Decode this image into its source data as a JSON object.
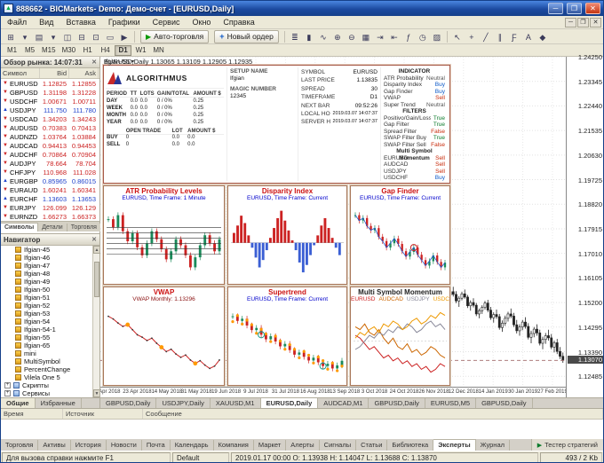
{
  "window": {
    "title": "888662 - BICMarkets- Demo: Демо-счет - [EURUSD,Daily]",
    "buttons": {
      "minimize": "─",
      "maximize": "❐",
      "close": "✕"
    }
  },
  "menu": {
    "items": [
      "Файл",
      "Вид",
      "Вставка",
      "Графики",
      "Сервис",
      "Окно",
      "Справка"
    ]
  },
  "toolbar": {
    "left_icons": [
      {
        "name": "new-chart",
        "glyph": "⊞"
      },
      {
        "name": "new-chart-dropdown",
        "glyph": "▾"
      },
      {
        "name": "profiles",
        "glyph": "▤"
      },
      {
        "name": "profiles-dropdown",
        "glyph": "▾"
      },
      {
        "name": "market-watch-toggle",
        "glyph": "◫"
      },
      {
        "name": "data-window-toggle",
        "glyph": "⊟"
      },
      {
        "name": "navigator-toggle",
        "glyph": "⊡"
      },
      {
        "name": "terminal-toggle",
        "glyph": "▭"
      },
      {
        "name": "strategy-tester-toggle",
        "glyph": "▶"
      }
    ],
    "autotrade_label": "Авто-торговля",
    "new_order_label": "Новый ордер",
    "mid_icons": [
      {
        "name": "bar-chart-mode",
        "glyph": "≣"
      },
      {
        "name": "candlestick-mode",
        "glyph": "▮"
      },
      {
        "name": "line-chart-mode",
        "glyph": "∿"
      },
      {
        "name": "zoom-in",
        "glyph": "⊕"
      },
      {
        "name": "zoom-out",
        "glyph": "⊖"
      },
      {
        "name": "tile-windows",
        "glyph": "▦"
      },
      {
        "name": "auto-scroll",
        "glyph": "⇥"
      },
      {
        "name": "chart-shift",
        "glyph": "⇤"
      },
      {
        "name": "indicators-list",
        "glyph": "ƒ"
      },
      {
        "name": "periods-list",
        "glyph": "◷"
      },
      {
        "name": "templates",
        "glyph": "▨"
      }
    ],
    "right_icons": [
      {
        "name": "cursor-tool",
        "glyph": "↖"
      },
      {
        "name": "crosshair-tool",
        "glyph": "+"
      },
      {
        "name": "trendline-tool",
        "glyph": "╱"
      },
      {
        "name": "channel-tool",
        "glyph": "∥"
      },
      {
        "name": "fibonacci-tool",
        "glyph": "Ƒ"
      },
      {
        "name": "text-tool",
        "glyph": "A"
      },
      {
        "name": "arrows-tool",
        "glyph": "◆"
      }
    ]
  },
  "timeframes": {
    "items": [
      "M1",
      "M5",
      "M15",
      "M30",
      "H1",
      "H4",
      "D1",
      "W1",
      "MN"
    ],
    "active": "D1"
  },
  "market_watch": {
    "title": "Обзор рынка: 14:07:31",
    "columns": [
      "Символ",
      "Bid",
      "Ask"
    ],
    "rows": [
      {
        "symbol": "EURUSD",
        "bid": "1.12825",
        "ask": "1.12855",
        "dir": "down"
      },
      {
        "symbol": "GBPUSD",
        "bid": "1.31198",
        "ask": "1.31228",
        "dir": "down"
      },
      {
        "symbol": "USDCHF",
        "bid": "1.00671",
        "ask": "1.00711",
        "dir": "down"
      },
      {
        "symbol": "USDJPY",
        "bid": "111.750",
        "ask": "111.780",
        "dir": "up"
      },
      {
        "symbol": "USDCAD",
        "bid": "1.34203",
        "ask": "1.34243",
        "dir": "down"
      },
      {
        "symbol": "AUDUSD",
        "bid": "0.70383",
        "ask": "0.70413",
        "dir": "down"
      },
      {
        "symbol": "AUDNZD",
        "bid": "1.03764",
        "ask": "1.03884",
        "dir": "down"
      },
      {
        "symbol": "AUDCAD",
        "bid": "0.94413",
        "ask": "0.94453",
        "dir": "down"
      },
      {
        "symbol": "AUDCHF",
        "bid": "0.70864",
        "ask": "0.70904",
        "dir": "down"
      },
      {
        "symbol": "AUDJPY",
        "bid": "78.664",
        "ask": "78.704",
        "dir": "down"
      },
      {
        "symbol": "CHFJPY",
        "bid": "110.968",
        "ask": "111.028",
        "dir": "down"
      },
      {
        "symbol": "EURGBP",
        "bid": "0.85965",
        "ask": "0.86015",
        "dir": "up"
      },
      {
        "symbol": "EURAUD",
        "bid": "1.60241",
        "ask": "1.60341",
        "dir": "down"
      },
      {
        "symbol": "EURCHF",
        "bid": "1.13603",
        "ask": "1.13653",
        "dir": "up"
      },
      {
        "symbol": "EURJPY",
        "bid": "126.099",
        "ask": "126.129",
        "dir": "down"
      },
      {
        "symbol": "EURNZD",
        "bid": "1.66273",
        "ask": "1.66373",
        "dir": "down"
      }
    ],
    "tabs": [
      "Символы",
      "Детали",
      "Торговля"
    ],
    "active_tab": "Символы"
  },
  "navigator": {
    "title": "Навигатор",
    "items": [
      {
        "label": "Ifgian-45",
        "kind": "expert"
      },
      {
        "label": "Ifgian-46",
        "kind": "expert"
      },
      {
        "label": "Ifgian-47",
        "kind": "expert"
      },
      {
        "label": "Ifgian-48",
        "kind": "expert"
      },
      {
        "label": "Ifgian-49",
        "kind": "expert"
      },
      {
        "label": "Ifgian-50",
        "kind": "expert"
      },
      {
        "label": "Ifgian-51",
        "kind": "expert"
      },
      {
        "label": "Ifgian-52",
        "kind": "expert"
      },
      {
        "label": "Ifgian-53",
        "kind": "expert"
      },
      {
        "label": "Ifgian-54",
        "kind": "expert"
      },
      {
        "label": "Ifgian-54-1",
        "kind": "expert"
      },
      {
        "label": "Ifgian-55",
        "kind": "expert"
      },
      {
        "label": "Ifgian-65",
        "kind": "expert"
      },
      {
        "label": "mini",
        "kind": "expert"
      },
      {
        "label": "MultiSymbol",
        "kind": "expert"
      },
      {
        "label": "PercentChange",
        "kind": "expert"
      },
      {
        "label": "Vilela One 5",
        "kind": "expert"
      },
      {
        "label": "Скрипты",
        "kind": "group"
      },
      {
        "label": "Сервисы",
        "kind": "group"
      }
    ],
    "tabs": [
      "Общие",
      "Избранные"
    ],
    "active_tab": "Общие"
  },
  "setup_panel": {
    "logo_text": "ALGORITHMUS",
    "fields_left": [
      [
        "SETUP NAME",
        "Ifgian"
      ],
      [
        "MAGIC NUMBER",
        "12345"
      ]
    ],
    "fields_mid": [
      [
        "SYMBOL",
        "EURUSD"
      ],
      [
        "LAST PRICE",
        "1.13835"
      ],
      [
        "SPREAD",
        "30"
      ],
      [
        "TIMEFRAME",
        "D1"
      ],
      [
        "NEXT BAR",
        "09:52:26"
      ],
      [
        "LOCAL HOUR",
        "2019.03.07 14:07:37"
      ],
      [
        "SERVER HOUR",
        "2019.03.07 14:07:37"
      ]
    ],
    "indicator_header": "INDICATOR",
    "indicators": [
      [
        "ATR Probability Levels",
        "Neutral"
      ],
      [
        "Disparity Index",
        "Buy"
      ],
      [
        "Gap Finder",
        "Buy"
      ],
      [
        "VWAP",
        "Sell"
      ],
      [
        "Super Trend",
        "Neutral"
      ]
    ],
    "filters_header": "FILTERS",
    "filters": [
      [
        "Positivo/Gain/Loss",
        "True"
      ],
      [
        "Gap Filter",
        "True"
      ],
      [
        "Spread Filter",
        "False"
      ],
      [
        "SWAP Filter Buy",
        "True"
      ],
      [
        "SWAP Filter Sell",
        "False"
      ]
    ],
    "msm_header": "Multi Symbol Momentum",
    "msm": [
      [
        "EURUSD",
        "Sell"
      ],
      [
        "AUDCAD",
        "Sell"
      ],
      [
        "USDJPY",
        "Sell"
      ],
      [
        "USDCHF",
        "Buy"
      ]
    ],
    "period_table": {
      "columns": [
        "PERIOD",
        "TT",
        "LOTS",
        "GAIN/TOTAL",
        "AMOUNT $"
      ],
      "rows": [
        [
          "DAY",
          "0.0",
          "0.0",
          "0 / 0%",
          "0.25"
        ],
        [
          "WEEK",
          "0.0",
          "0.0",
          "0 / 0%",
          "0.25"
        ],
        [
          "MONTH",
          "0.0",
          "0.0",
          "0 / 0%",
          "0.25"
        ],
        [
          "YEAR",
          "0.0",
          "0.0",
          "0 / 0%",
          "0.25"
        ]
      ]
    },
    "open_trade": {
      "columns": [
        "",
        "OPEN TRADE",
        "LOT",
        "AMOUNT $"
      ],
      "rows": [
        [
          "BUY",
          "0",
          "0.0",
          "0.0"
        ],
        [
          "SELL",
          "0",
          "0.0",
          "0.0"
        ]
      ]
    }
  },
  "main_chart": {
    "ohlc_line": "EURUSD,Daily  1.13065 1.13109 1.12905 1.12935",
    "ea_label": "Ifgian-55",
    "current_price": "1.13070",
    "price_range": {
      "max": 1.2425,
      "min": 1.121
    },
    "price_labels": [
      "1.24250",
      "1.23345",
      "1.22440",
      "1.21535",
      "1.20630",
      "1.19725",
      "1.18820",
      "1.17915",
      "1.17010",
      "1.16105",
      "1.15200",
      "1.14295",
      "1.13390",
      "1.12485"
    ],
    "dates": [
      "4 Apr 2018",
      "23 Apr 2018",
      "14 May 2018",
      "31 May 2018",
      "19 Jun 2018",
      "9 Jul 2018",
      "31 Jul 2018",
      "16 Aug 2018",
      "13 Sep 2018",
      "3 Oct 2018",
      "24 Oct 2018",
      "26 Nov 2018",
      "12 Dec 2018",
      "14 Jan 2019",
      "30 Jan 2019",
      "27 Feb 2019"
    ],
    "candles": [
      [
        1.1548,
        1.1572,
        1.1534,
        1.156
      ],
      [
        1.156,
        1.1578,
        1.1542,
        1.155
      ],
      [
        1.155,
        1.1562,
        1.1518,
        1.1526
      ],
      [
        1.1526,
        1.1544,
        1.1504,
        1.1536
      ],
      [
        1.1536,
        1.156,
        1.1528,
        1.1552
      ],
      [
        1.1552,
        1.1568,
        1.1534,
        1.154
      ],
      [
        1.154,
        1.1548,
        1.15,
        1.1508
      ],
      [
        1.1508,
        1.1528,
        1.149,
        1.152
      ],
      [
        1.152,
        1.1536,
        1.1502,
        1.151
      ],
      [
        1.151,
        1.1518,
        1.147,
        1.1478
      ],
      [
        1.1478,
        1.1498,
        1.1462,
        1.149
      ],
      [
        1.149,
        1.151,
        1.1478,
        1.1502
      ],
      [
        1.1502,
        1.1526,
        1.1494,
        1.1518
      ],
      [
        1.1518,
        1.153,
        1.1484,
        1.1492
      ],
      [
        1.1492,
        1.1504,
        1.1456,
        1.1464
      ],
      [
        1.1464,
        1.1484,
        1.1446,
        1.1476
      ],
      [
        1.1476,
        1.1494,
        1.146,
        1.1468
      ],
      [
        1.1468,
        1.1478,
        1.142,
        1.1428
      ],
      [
        1.1428,
        1.1454,
        1.1412,
        1.1444
      ],
      [
        1.1444,
        1.1472,
        1.1434,
        1.1462
      ],
      [
        1.1462,
        1.1486,
        1.145,
        1.1478
      ],
      [
        1.1478,
        1.1498,
        1.1462,
        1.147
      ],
      [
        1.147,
        1.1482,
        1.143,
        1.1438
      ],
      [
        1.1438,
        1.1456,
        1.1406,
        1.1416
      ],
      [
        1.1416,
        1.144,
        1.1398,
        1.143
      ],
      [
        1.143,
        1.1456,
        1.1418,
        1.1448
      ],
      [
        1.1448,
        1.1466,
        1.1424,
        1.1432
      ],
      [
        1.1432,
        1.1444,
        1.1384,
        1.1392
      ],
      [
        1.1392,
        1.1416,
        1.137,
        1.1406
      ],
      [
        1.1406,
        1.143,
        1.1392,
        1.1422
      ],
      [
        1.1422,
        1.144,
        1.1398,
        1.1408
      ],
      [
        1.1408,
        1.142,
        1.1362,
        1.137
      ],
      [
        1.137,
        1.1394,
        1.1348,
        1.1384
      ],
      [
        1.1384,
        1.1408,
        1.1368,
        1.1398
      ],
      [
        1.1398,
        1.142,
        1.138,
        1.139
      ],
      [
        1.139,
        1.1404,
        1.1348,
        1.1356
      ],
      [
        1.1356,
        1.138,
        1.1336,
        1.1372
      ],
      [
        1.1372,
        1.1386,
        1.133,
        1.134
      ],
      [
        1.134,
        1.1356,
        1.1312,
        1.1322
      ],
      [
        1.1322,
        1.1336,
        1.1298,
        1.1307
      ]
    ]
  },
  "mini_charts": [
    {
      "title": "ATR Probability Levels",
      "subtitle": "EURUSD, Time Frame: 1 Minute",
      "type": "atr",
      "values": [
        1.1296,
        1.1292,
        1.1298,
        1.129,
        1.1285,
        1.1289,
        1.1282,
        1.1278,
        1.1284,
        1.129,
        1.1286,
        1.1281,
        1.1276,
        1.128,
        1.1286,
        1.1283,
        1.1278,
        1.1272,
        1.1277,
        1.1283,
        1.1288,
        1.1284,
        1.128,
        1.1286
      ]
    },
    {
      "title": "Disparity Index",
      "subtitle": "EURUSD, Time Frame: Current",
      "type": "histogram",
      "values": [
        0.4,
        0.7,
        1.1,
        0.8,
        0.3,
        -0.2,
        -0.6,
        -1.0,
        -0.7,
        -0.3,
        0.2,
        0.6,
        1.0,
        1.3,
        0.9,
        0.5,
        0.1,
        -0.3,
        -0.8,
        -1.2,
        -0.9,
        -0.5,
        -0.1,
        0.3,
        0.7,
        1.0,
        0.6,
        0.2,
        -0.2,
        -0.5
      ]
    },
    {
      "title": "Gap Finder",
      "subtitle": "EURUSD, Time Frame: Current",
      "type": "gap",
      "values": [
        1.148,
        1.1465,
        1.1472,
        1.145,
        1.1438,
        1.1444,
        1.142,
        1.1408,
        1.139,
        1.1402,
        1.1415,
        1.14,
        1.138,
        1.1365,
        1.1378,
        1.139,
        1.137,
        1.1355,
        1.134,
        1.1352,
        1.1368,
        1.135,
        1.1335,
        1.1348
      ]
    },
    {
      "title": "VWAP",
      "subtitle": "VWAP Monthly: 1.13296",
      "subtitle_color": "#8a1010",
      "type": "vwap",
      "values": [
        1.146,
        1.1452,
        1.144,
        1.143,
        1.1435,
        1.142,
        1.1405,
        1.1398,
        1.1388,
        1.1395,
        1.138,
        1.1368,
        1.1355,
        1.1362,
        1.1348,
        1.1338,
        1.1345,
        1.133,
        1.132,
        1.1328,
        1.1315,
        1.1305,
        1.1312,
        1.133
      ]
    },
    {
      "title": "Supertrend",
      "subtitle": "EURUSD, Time Frame: Current",
      "type": "supertrend",
      "values": [
        1.147,
        1.1455,
        1.1462,
        1.144,
        1.1425,
        1.1432,
        1.141,
        1.1395,
        1.1405,
        1.1388,
        1.1372,
        1.138,
        1.136,
        1.1345,
        1.1352,
        1.1338,
        1.1326,
        1.1335,
        1.132,
        1.1308,
        1.1315,
        1.13,
        1.131,
        1.1325
      ]
    },
    {
      "title": "Multi Symbol Momentum",
      "title_color": "#222222",
      "type": "multiline",
      "series": [
        {
          "name": "EURUSD",
          "color": "#cc2222",
          "values": [
            0.2,
            0.1,
            -0.1,
            -0.3,
            -0.2,
            -0.4,
            -0.6,
            -0.5,
            -0.7,
            -0.6,
            -0.8,
            -0.7,
            -0.9,
            -0.8,
            -1.0,
            -0.9,
            -1.1,
            -1.0,
            -0.8,
            -0.9
          ]
        },
        {
          "name": "AUDCAD",
          "color": "#cc6600",
          "values": [
            0.5,
            0.4,
            0.6,
            0.3,
            0.2,
            0.4,
            0.1,
            -0.1,
            0.1,
            -0.2,
            -0.3,
            -0.1,
            -0.4,
            -0.3,
            -0.5,
            -0.4,
            -0.2,
            -0.3,
            -0.5,
            -0.6
          ]
        },
        {
          "name": "USDJPY",
          "color": "#888899",
          "values": [
            -0.3,
            -0.2,
            0.0,
            0.2,
            0.1,
            0.3,
            0.2,
            0.4,
            0.3,
            0.5,
            0.4,
            0.6,
            0.5,
            0.3,
            0.4,
            0.6,
            0.7,
            0.5,
            0.6,
            0.4
          ]
        },
        {
          "name": "USDCHF",
          "color": "#ee9900",
          "values": [
            0.1,
            0.3,
            0.2,
            0.4,
            0.5,
            0.3,
            0.6,
            0.5,
            0.7,
            0.6,
            0.4,
            0.5,
            0.7,
            0.8,
            0.6,
            0.7,
            0.9,
            0.8,
            1.0,
            0.9
          ]
        }
      ]
    }
  ],
  "chart_tabs": {
    "items": [
      "GBPUSD,Daily",
      "USDJPY,Daily",
      "XAUUSD,M1",
      "EURUSD,Daily",
      "AUDCAD,M1",
      "GBPUSD,Daily",
      "EURUSD,M5",
      "GBPUSD,Daily"
    ],
    "active_index": 3
  },
  "terminal": {
    "columns": [
      "Время",
      "Источник",
      "Сообщение"
    ],
    "tabs": [
      "Торговля",
      "Активы",
      "История",
      "Новости",
      "Почта",
      "Календарь",
      "Компания",
      "Маркет",
      "Алерты",
      "Сигналы",
      "Статьи",
      "Библиотека",
      "Эксперты",
      "Журнал"
    ],
    "active_tab": "Эксперты",
    "tester_label": "Тестер стратегий"
  },
  "statusbar": {
    "help": "Для вызова справки нажмите F1",
    "profile": "Default",
    "bar_info": "2019.01.17 00:00   O: 1.13938   H: 1.14047   L: 1.13688   C: 1.13870",
    "traffic": "493 / 2 Kb"
  }
}
